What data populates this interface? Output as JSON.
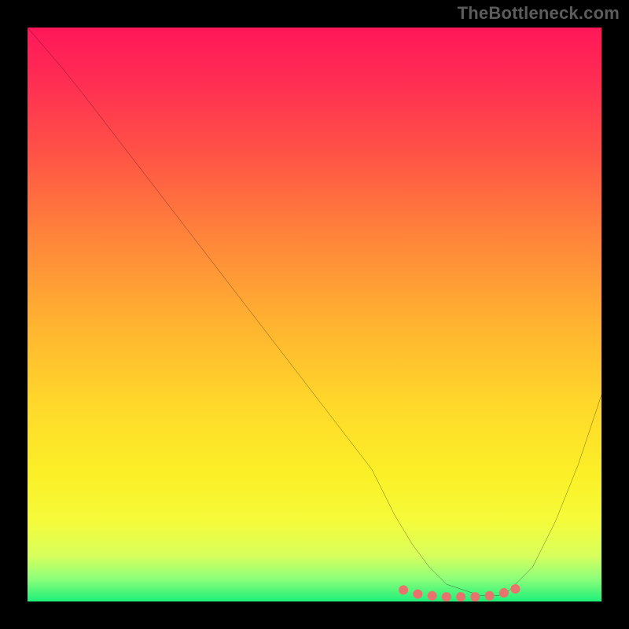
{
  "watermark": "TheBottleneck.com",
  "chart_data": {
    "type": "line",
    "title": "",
    "xlabel": "",
    "ylabel": "",
    "xlim": [
      0,
      100
    ],
    "ylim": [
      0,
      100
    ],
    "grid": false,
    "legend": false,
    "background": "vertical-gradient red→yellow→green",
    "series": [
      {
        "name": "bottleneck-curve",
        "x": [
          0,
          6,
          10,
          20,
          30,
          40,
          50,
          60,
          64,
          67,
          70,
          73,
          76,
          79,
          82,
          84,
          88,
          92,
          96,
          100
        ],
        "y": [
          100,
          93,
          88,
          75,
          62,
          49,
          36,
          23,
          15,
          10,
          6,
          3,
          2,
          1,
          1,
          2,
          6,
          14,
          24,
          36
        ]
      }
    ],
    "markers": [
      {
        "name": "sweet-spot-dot",
        "x": 65.5,
        "y": 2.0
      },
      {
        "name": "sweet-spot-dot",
        "x": 68.0,
        "y": 1.3
      },
      {
        "name": "sweet-spot-dot",
        "x": 70.5,
        "y": 1.0
      },
      {
        "name": "sweet-spot-dot",
        "x": 73.0,
        "y": 0.8
      },
      {
        "name": "sweet-spot-dot",
        "x": 75.5,
        "y": 0.8
      },
      {
        "name": "sweet-spot-dot",
        "x": 78.0,
        "y": 0.8
      },
      {
        "name": "sweet-spot-dot",
        "x": 80.5,
        "y": 1.0
      },
      {
        "name": "sweet-spot-dot",
        "x": 83.0,
        "y": 1.5
      },
      {
        "name": "sweet-spot-dot",
        "x": 85.0,
        "y": 2.2
      }
    ],
    "marker_style": {
      "color": "#e8736c",
      "radius_px": 6
    }
  }
}
